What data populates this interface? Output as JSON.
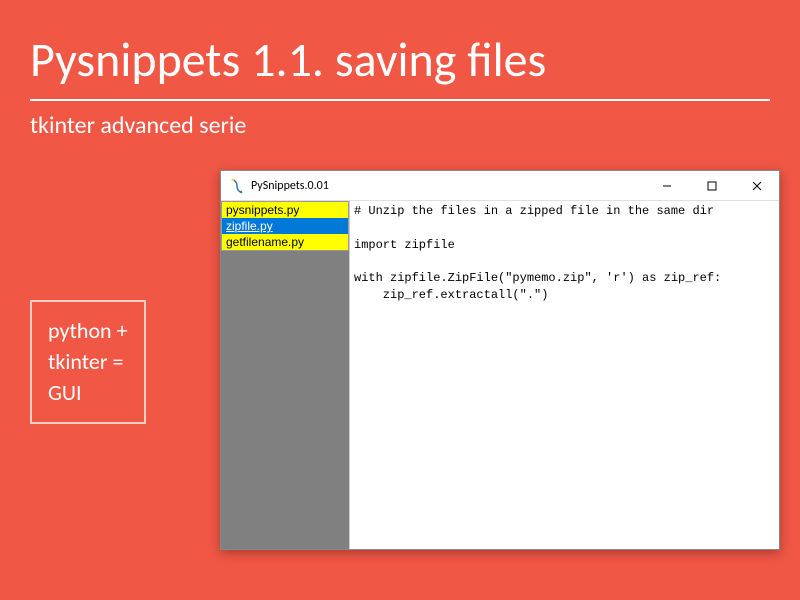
{
  "header": {
    "title": "Pysnippets 1.1. saving files",
    "subtitle": "tkinter advanced serie"
  },
  "sidebox": {
    "line1": "python +",
    "line2": "tkinter =",
    "line3": "GUI"
  },
  "window": {
    "title": "PySnippets.0.01",
    "files": [
      {
        "name": "pysnippets.py",
        "selected": false
      },
      {
        "name": "zipfile.py",
        "selected": true
      },
      {
        "name": "getfilename.py",
        "selected": false
      }
    ],
    "code": "# Unzip the files in a zipped file in the same dir\n\nimport zipfile\n\nwith zipfile.ZipFile(\"pymemo.zip\", 'r') as zip_ref:\n    zip_ref.extractall(\".\")"
  }
}
